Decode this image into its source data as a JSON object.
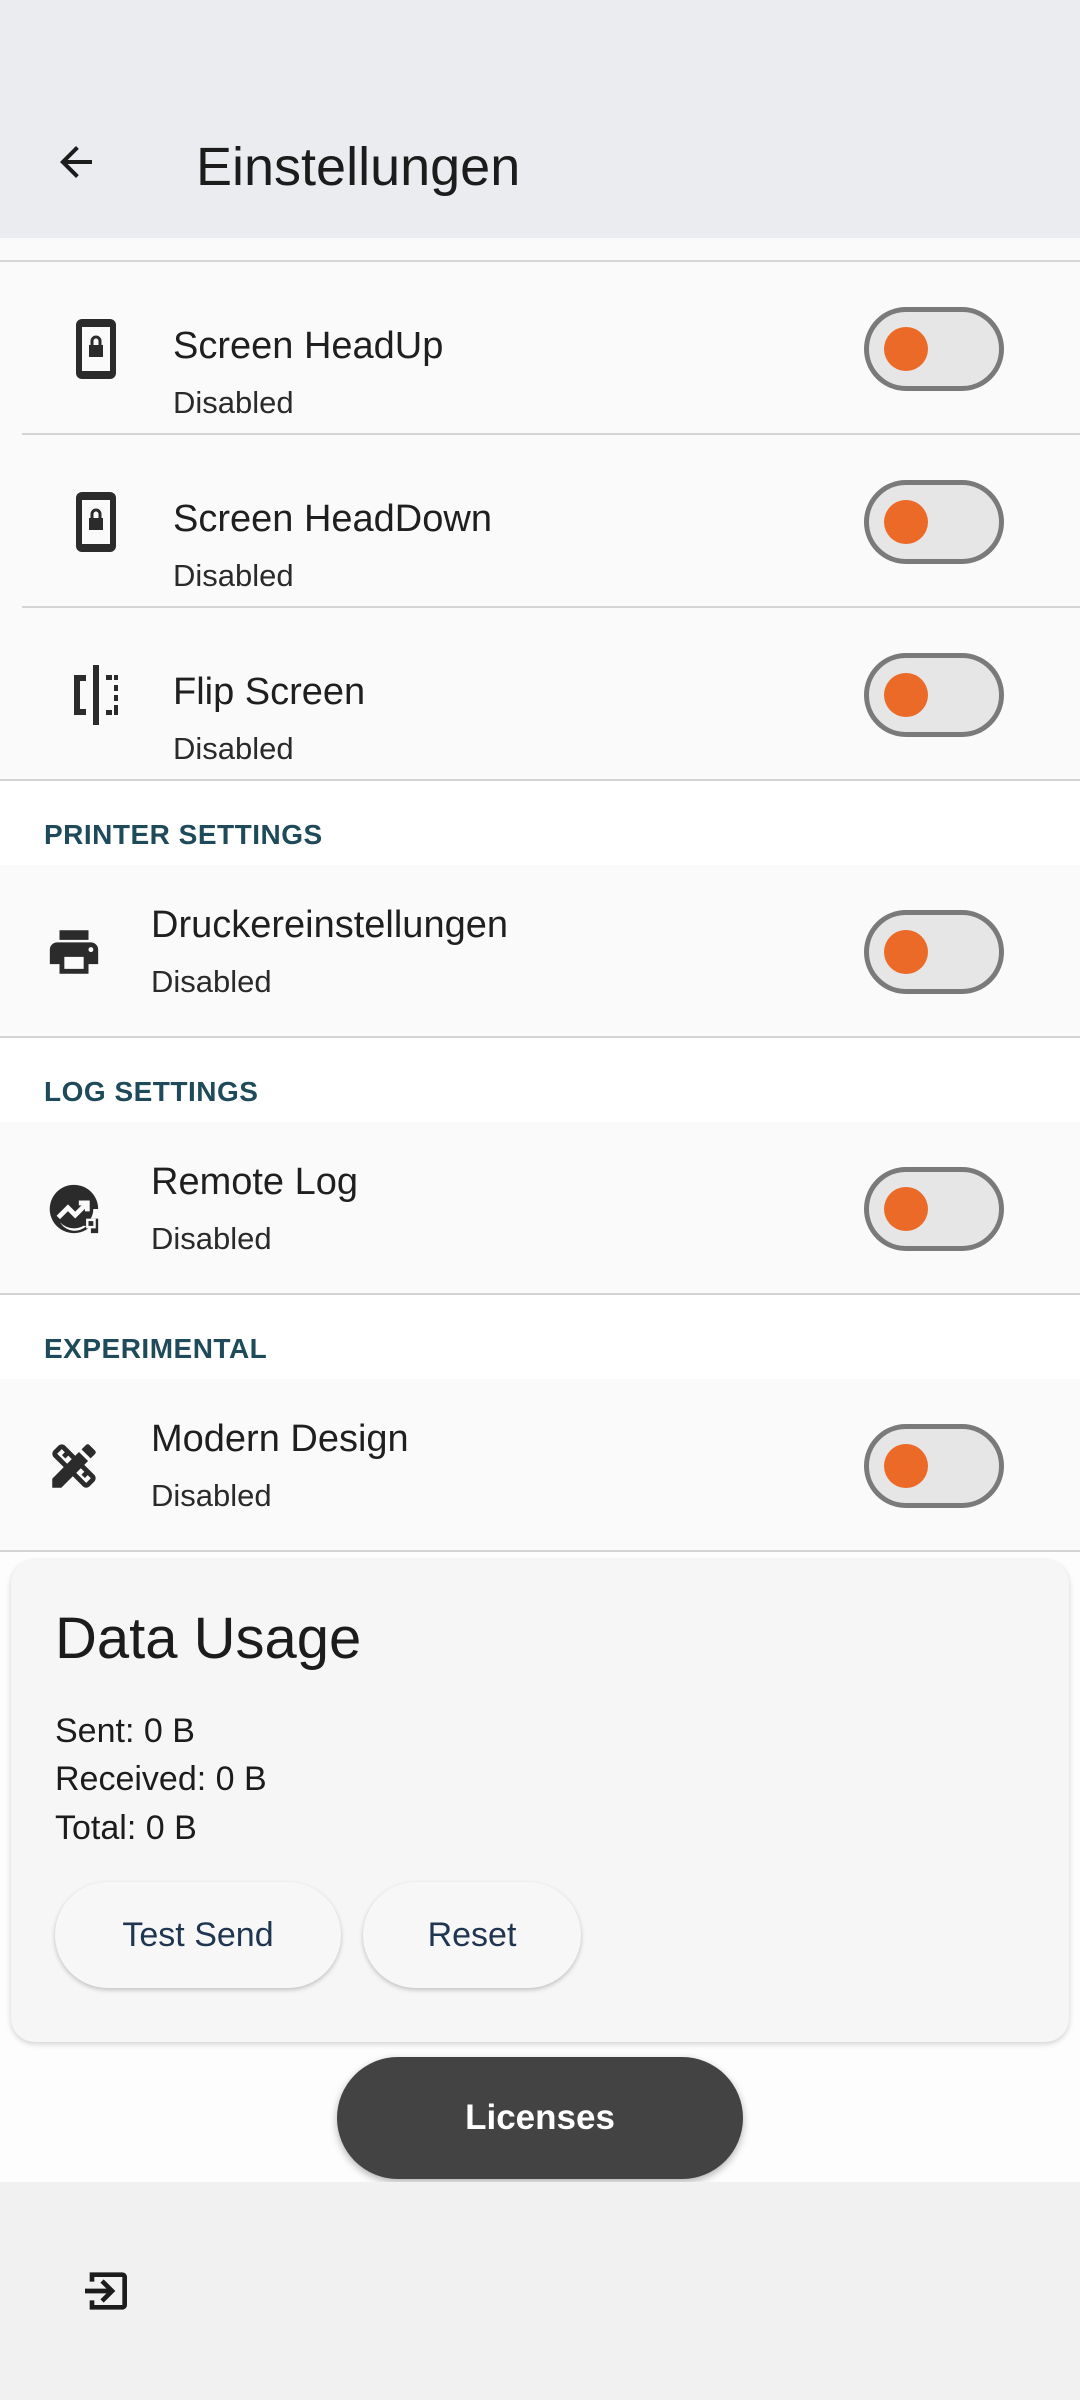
{
  "appbar": {
    "title": "Einstellungen"
  },
  "rows_top": [
    {
      "title": "Screen HeadUp",
      "subtitle": "Disabled"
    },
    {
      "title": "Screen HeadDown",
      "subtitle": "Disabled"
    },
    {
      "title": "Flip Screen",
      "subtitle": "Disabled"
    }
  ],
  "sections": {
    "printer": {
      "header": "PRINTER SETTINGS",
      "title": "Druckereinstellungen",
      "subtitle": "Disabled"
    },
    "log": {
      "header": "LOG SETTINGS",
      "title": "Remote Log",
      "subtitle": "Disabled"
    },
    "experimental": {
      "header": "EXPERIMENTAL",
      "title": "Modern Design",
      "subtitle": "Disabled"
    }
  },
  "data_usage": {
    "title": "Data Usage",
    "sent": "Sent: 0 B",
    "received": "Received: 0 B",
    "total": "Total: 0 B",
    "test_send_label": "Test Send",
    "reset_label": "Reset"
  },
  "licenses_label": "Licenses",
  "colors": {
    "accent": "#EC6A28",
    "section_header": "#1E4A5A",
    "appbar": "#EBECF0"
  }
}
